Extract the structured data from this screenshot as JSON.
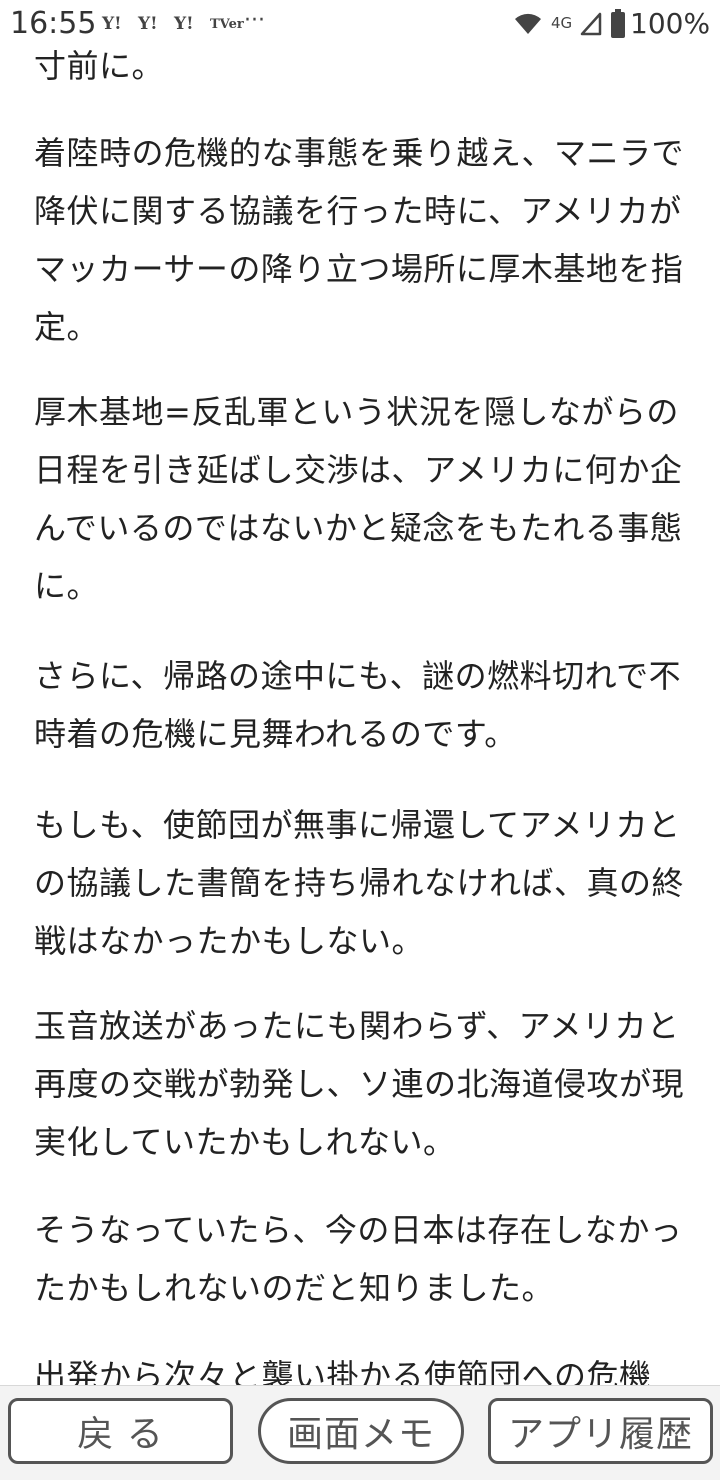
{
  "status_bar": {
    "time": "16:55",
    "notification_icons": [
      "Y!",
      "Y!",
      "Y!",
      "TVer"
    ],
    "more": "···",
    "network": "4G",
    "battery": "100%"
  },
  "article": {
    "paragraphs": [
      [
        "寸前に。"
      ],
      [
        "着陸時の危機的な事態を乗り越え、マニラで",
        "降伏に関する協議を行った時に、アメリカが",
        "マッカーサーの降り立つ場所に厚木基地を指",
        "定。"
      ],
      [
        "厚木基地=反乱軍という状況を隠しながらの",
        "日程を引き延ばし交渉は、アメリカに何か企",
        "んでいるのではないかと疑念をもたれる事態",
        "に。"
      ],
      [
        "さらに、帰路の途中にも、謎の燃料切れで不",
        "時着の危機に見舞われるのです。"
      ],
      [
        "もしも、使節団が無事に帰還してアメリカと",
        "の協議した書簡を持ち帰れなければ、真の終",
        "戦はなかったかもしない。"
      ],
      [
        "玉音放送があったにも関わらず、アメリカと",
        "再度の交戦が勃発し、ソ連の北海道侵攻が現",
        "実化していたかもしれない。"
      ],
      [
        "そうなっていたら、今の日本は存在しなかっ",
        "たかもしれないのだと知りました。"
      ],
      [
        "出発から次々と襲い掛かる使節団への危機"
      ]
    ]
  },
  "bottom_bar": {
    "back_label": "戻 る",
    "memo_label": "画面メモ",
    "history_label": "アプリ履歴"
  }
}
